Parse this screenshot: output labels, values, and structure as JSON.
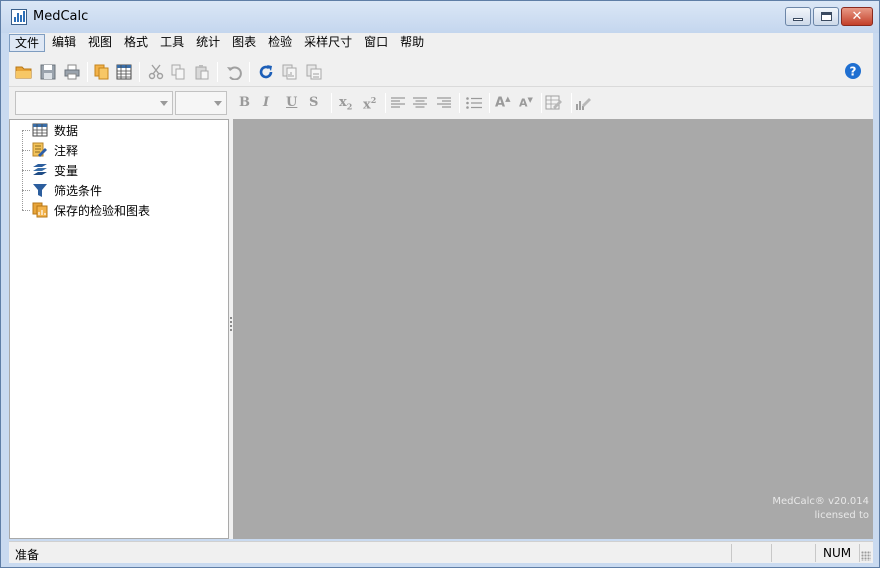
{
  "window": {
    "title": "MedCalc",
    "minimize_icon": "minimize-icon",
    "maximize_icon": "maximize-icon",
    "close_icon": "close-icon"
  },
  "menu": {
    "items": [
      "文件",
      "编辑",
      "视图",
      "格式",
      "工具",
      "统计",
      "图表",
      "检验",
      "采样尺寸",
      "窗口",
      "帮助"
    ],
    "active_index": 0
  },
  "toolbar": {
    "standard_icons": [
      "open-folder-icon",
      "save-icon",
      "print-icon",
      "copy-files-icon",
      "spreadsheet-icon",
      "cut-icon",
      "copy-icon",
      "paste-icon",
      "undo-icon",
      "refresh-icon",
      "copy-graph-icon",
      "format-graph-icon",
      "help-icon"
    ],
    "font_name_value": "",
    "font_size_value": "",
    "format_labels": {
      "bold": "B",
      "italic": "I",
      "underline": "U",
      "strike": "S",
      "subscript": "x",
      "subscript_mark": "2",
      "superscript": "x",
      "superscript_mark": "2",
      "increase_font": "A",
      "decrease_font": "A"
    }
  },
  "tree": {
    "items": [
      {
        "label": "数据",
        "icon": "spreadsheet-icon"
      },
      {
        "label": "注释",
        "icon": "notes-icon"
      },
      {
        "label": "变量",
        "icon": "variables-icon"
      },
      {
        "label": "筛选条件",
        "icon": "filter-icon"
      },
      {
        "label": "保存的检验和图表",
        "icon": "saved-tests-icon"
      }
    ]
  },
  "workspace": {
    "version": "MedCalc® v20.014",
    "licensed": "licensed to"
  },
  "statusbar": {
    "status": "准备",
    "num": "NUM"
  },
  "colors": {
    "workspace_bg": "#a9a9a9",
    "help_blue": "#1f6fd1",
    "refresh_blue": "#1d5fb8",
    "folder_orange": "#e8a53a"
  }
}
